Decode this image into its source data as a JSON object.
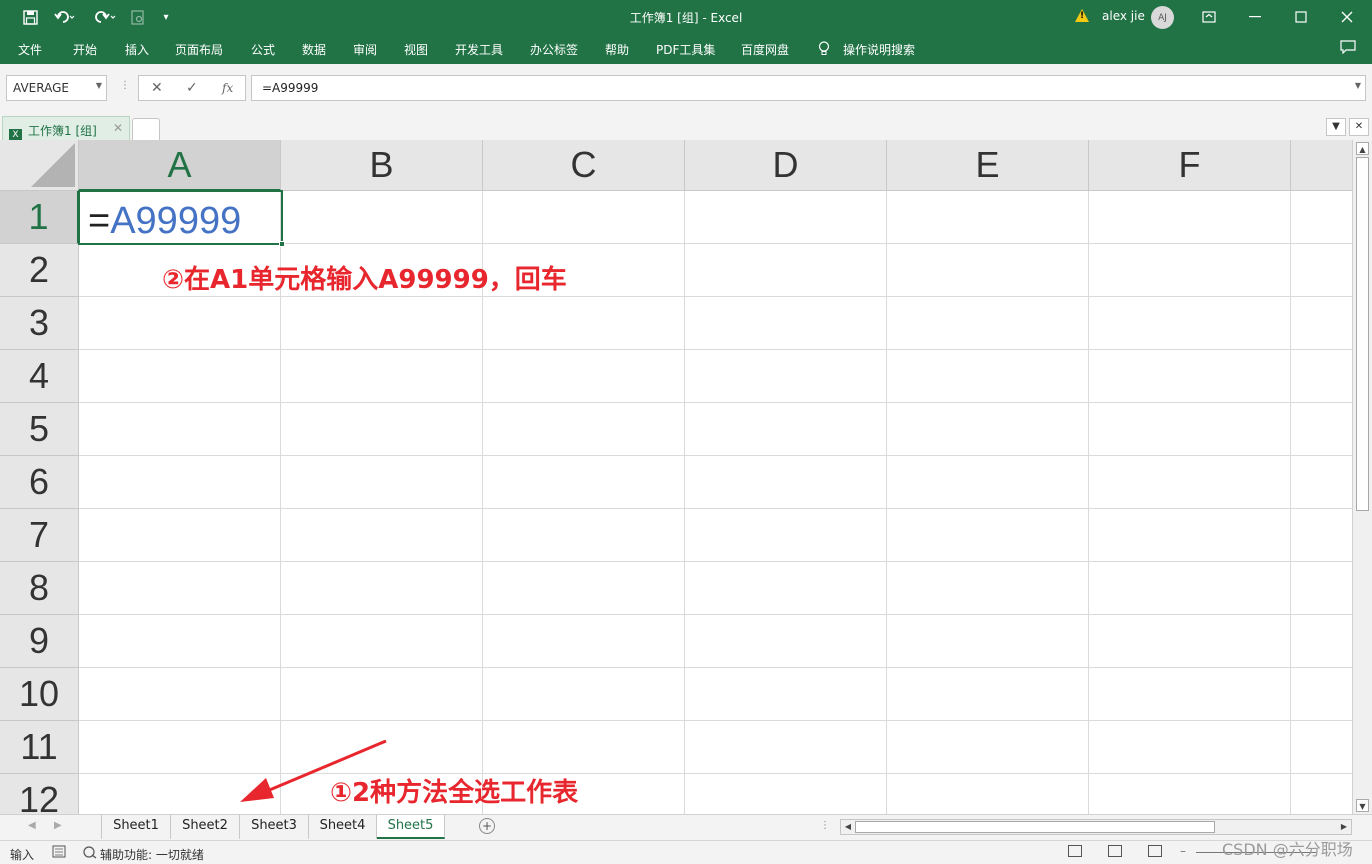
{
  "window": {
    "title": "工作簿1  [组]  -  Excel",
    "user": "alex jie",
    "avatar_initials": "AJ",
    "warning_icon": "warning-icon",
    "accent_color": "#217346"
  },
  "quick_access": {
    "save_icon": "save-icon",
    "undo_icon": "undo-icon",
    "redo_icon": "redo-icon",
    "preview_icon": "print-preview-icon",
    "customize_icon": "customize-qat-icon"
  },
  "ribbon": {
    "tabs": [
      "文件",
      "开始",
      "插入",
      "页面布局",
      "公式",
      "数据",
      "审阅",
      "视图",
      "开发工具",
      "办公标签",
      "帮助",
      "PDF工具集",
      "百度网盘"
    ],
    "tell_me": "操作说明搜索"
  },
  "formula_bar": {
    "name_box": "AVERAGE",
    "cancel": "✕",
    "enter": "✓",
    "fx": "fx",
    "formula": "=A99999"
  },
  "document_tab": {
    "label": "工作簿1  [组]",
    "close": "✕"
  },
  "grid": {
    "columns": [
      "A",
      "B",
      "C",
      "D",
      "E",
      "F"
    ],
    "selected_column": "A",
    "rows": [
      "1",
      "2",
      "3",
      "4",
      "5",
      "6",
      "7",
      "8",
      "9",
      "10",
      "11",
      "12"
    ],
    "selected_row": "1",
    "active_cell": {
      "address": "A1",
      "eq": "=",
      "ref": "A99999"
    }
  },
  "annotations": {
    "step2": "②在A1单元格输入A99999，回车",
    "step1": "①2种方法全选工作表",
    "color": "#e8262d"
  },
  "sheets": {
    "tabs": [
      "Sheet1",
      "Sheet2",
      "Sheet3",
      "Sheet4",
      "Sheet5"
    ],
    "active": "Sheet5",
    "add": "+"
  },
  "status": {
    "mode": "输入",
    "accessibility": "辅助功能: 一切就绪"
  },
  "watermark": "CSDN @六分职场"
}
